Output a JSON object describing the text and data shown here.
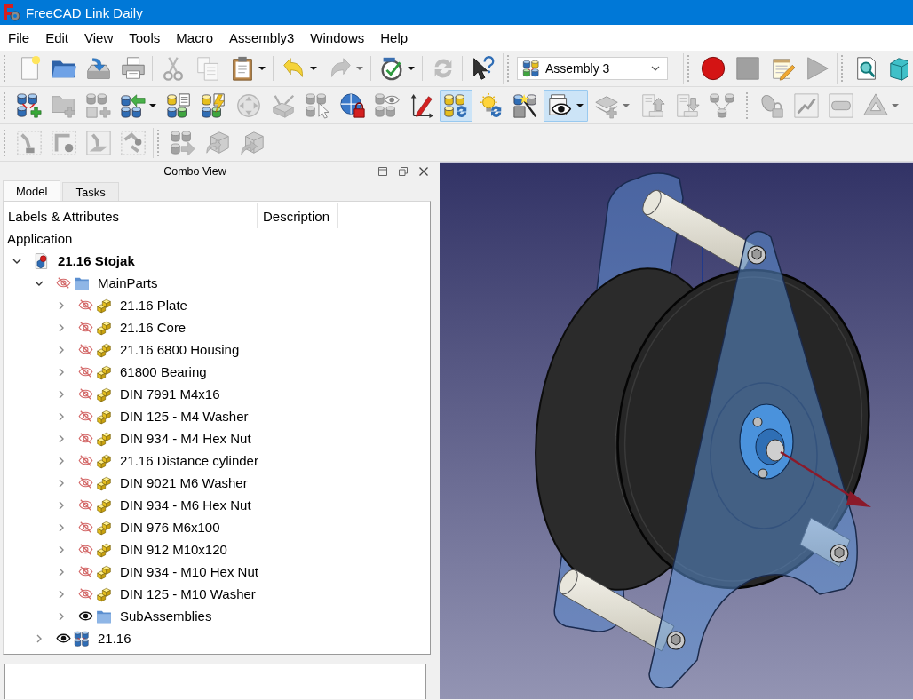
{
  "window": {
    "title": "FreeCAD Link Daily"
  },
  "menu_bar": [
    "File",
    "Edit",
    "View",
    "Tools",
    "Macro",
    "Assembly3",
    "Windows",
    "Help"
  ],
  "toolbar_rows": [
    {
      "items": [
        {
          "kind": "handle"
        },
        {
          "kind": "button",
          "disabled": false,
          "pressed": false,
          "dropdown": false
        },
        {
          "kind": "button",
          "disabled": false,
          "pressed": false,
          "dropdown": false
        },
        {
          "kind": "button",
          "disabled": false,
          "pressed": false,
          "dropdown": false
        },
        {
          "kind": "button",
          "disabled": false,
          "pressed": false,
          "dropdown": false
        },
        {
          "kind": "separator"
        },
        {
          "kind": "button",
          "disabled": true,
          "pressed": false,
          "dropdown": false
        },
        {
          "kind": "button",
          "disabled": true,
          "pressed": false,
          "dropdown": false
        },
        {
          "kind": "button",
          "disabled": false,
          "pressed": false,
          "dropdown": true
        },
        {
          "kind": "separator"
        },
        {
          "kind": "button",
          "disabled": false,
          "pressed": false,
          "dropdown": true
        },
        {
          "kind": "button",
          "disabled": true,
          "pressed": false,
          "dropdown": true
        },
        {
          "kind": "separator"
        },
        {
          "kind": "button",
          "disabled": false,
          "pressed": false,
          "dropdown": true
        },
        {
          "kind": "separator"
        },
        {
          "kind": "button",
          "disabled": true,
          "pressed": false,
          "dropdown": false
        },
        {
          "kind": "separator"
        },
        {
          "kind": "button",
          "disabled": false,
          "pressed": false,
          "dropdown": false
        },
        {
          "kind": "handle"
        },
        {
          "kind": "combo",
          "value": "Assembly 3"
        },
        {
          "kind": "handle"
        },
        {
          "kind": "button",
          "disabled": false,
          "pressed": false,
          "dropdown": false
        },
        {
          "kind": "button",
          "disabled": true,
          "pressed": false,
          "dropdown": false
        },
        {
          "kind": "button",
          "disabled": false,
          "pressed": false,
          "dropdown": false
        },
        {
          "kind": "button",
          "disabled": true,
          "pressed": false,
          "dropdown": false
        },
        {
          "kind": "handle"
        },
        {
          "kind": "button",
          "disabled": false,
          "pressed": false,
          "dropdown": false
        },
        {
          "kind": "button",
          "disabled": false,
          "pressed": false,
          "dropdown": false
        }
      ]
    },
    {
      "items": [
        {
          "kind": "handle"
        },
        {
          "kind": "button",
          "disabled": false,
          "pressed": false,
          "dropdown": false
        },
        {
          "kind": "button",
          "disabled": true,
          "pressed": false,
          "dropdown": false
        },
        {
          "kind": "button",
          "disabled": true,
          "pressed": false,
          "dropdown": false
        },
        {
          "kind": "button",
          "disabled": false,
          "pressed": false,
          "dropdown": true
        },
        {
          "kind": "button",
          "disabled": false,
          "pressed": false,
          "dropdown": false
        },
        {
          "kind": "button",
          "disabled": false,
          "pressed": false,
          "dropdown": false
        },
        {
          "kind": "button",
          "disabled": true,
          "pressed": false,
          "dropdown": false
        },
        {
          "kind": "button",
          "disabled": true,
          "pressed": false,
          "dropdown": false
        },
        {
          "kind": "button",
          "disabled": true,
          "pressed": false,
          "dropdown": false
        },
        {
          "kind": "button",
          "disabled": false,
          "pressed": false,
          "dropdown": false
        },
        {
          "kind": "button",
          "disabled": true,
          "pressed": false,
          "dropdown": false
        },
        {
          "kind": "button",
          "disabled": false,
          "pressed": false,
          "dropdown": false
        },
        {
          "kind": "button",
          "disabled": false,
          "pressed": true,
          "dropdown": false
        },
        {
          "kind": "button",
          "disabled": false,
          "pressed": false,
          "dropdown": false
        },
        {
          "kind": "button",
          "disabled": false,
          "pressed": false,
          "dropdown": false
        },
        {
          "kind": "button",
          "disabled": false,
          "pressed": true,
          "dropdown": true
        },
        {
          "kind": "button",
          "disabled": true,
          "pressed": false,
          "dropdown": true
        },
        {
          "kind": "button",
          "disabled": true,
          "pressed": false,
          "dropdown": false
        },
        {
          "kind": "button",
          "disabled": true,
          "pressed": false,
          "dropdown": false
        },
        {
          "kind": "button",
          "disabled": true,
          "pressed": false,
          "dropdown": false
        },
        {
          "kind": "handle"
        },
        {
          "kind": "button",
          "disabled": true,
          "pressed": false,
          "dropdown": false
        },
        {
          "kind": "button",
          "disabled": true,
          "pressed": false,
          "dropdown": false
        },
        {
          "kind": "button",
          "disabled": true,
          "pressed": false,
          "dropdown": false
        },
        {
          "kind": "button",
          "disabled": true,
          "pressed": false,
          "dropdown": true
        }
      ]
    },
    {
      "items": [
        {
          "kind": "handle"
        },
        {
          "kind": "button",
          "disabled": true,
          "pressed": false,
          "dropdown": false
        },
        {
          "kind": "button",
          "disabled": true,
          "pressed": false,
          "dropdown": false
        },
        {
          "kind": "button",
          "disabled": true,
          "pressed": false,
          "dropdown": false
        },
        {
          "kind": "button",
          "disabled": true,
          "pressed": false,
          "dropdown": false
        },
        {
          "kind": "handle"
        },
        {
          "kind": "button",
          "disabled": true,
          "pressed": false,
          "dropdown": false
        },
        {
          "kind": "button",
          "disabled": true,
          "pressed": false,
          "dropdown": false
        },
        {
          "kind": "button",
          "disabled": true,
          "pressed": false,
          "dropdown": false
        }
      ]
    }
  ],
  "combo_view": {
    "title": "Combo View",
    "tabs": [
      {
        "label": "Model",
        "selected": true
      },
      {
        "label": "Tasks",
        "selected": false
      }
    ],
    "tree": {
      "columns": [
        "Labels & Attributes",
        "Description"
      ],
      "section": "Application",
      "items": [
        {
          "label": "21.16 Stojak",
          "kind": "document",
          "selected": false,
          "expanded": true,
          "children": [
            {
              "label": "MainParts",
              "kind": "folder",
              "visible": false,
              "selected": false,
              "expanded": true,
              "children": [
                {
                  "label": "21.16 Plate",
                  "kind": "part",
                  "visible": false,
                  "selected": false,
                  "expanded": false
                },
                {
                  "label": "21.16 Core",
                  "kind": "part",
                  "visible": false,
                  "selected": false,
                  "expanded": false
                },
                {
                  "label": "21.16 6800 Housing",
                  "kind": "part",
                  "visible": false,
                  "selected": false,
                  "expanded": false
                },
                {
                  "label": "61800 Bearing",
                  "kind": "part",
                  "visible": false,
                  "selected": false,
                  "expanded": false
                },
                {
                  "label": "DIN 7991 M4x16",
                  "kind": "part",
                  "visible": false,
                  "selected": false,
                  "expanded": false
                },
                {
                  "label": "DIN 125 - M4 Washer",
                  "kind": "part",
                  "visible": false,
                  "selected": false,
                  "expanded": false
                },
                {
                  "label": "DIN 934 - M4 Hex Nut",
                  "kind": "part",
                  "visible": false,
                  "selected": false,
                  "expanded": false
                },
                {
                  "label": "21.16 Distance cylinder",
                  "kind": "part",
                  "visible": false,
                  "selected": false,
                  "expanded": false
                },
                {
                  "label": "DIN 9021 M6 Washer",
                  "kind": "part",
                  "visible": false,
                  "selected": false,
                  "expanded": false
                },
                {
                  "label": "DIN 934 - M6 Hex Nut",
                  "kind": "part",
                  "visible": false,
                  "selected": false,
                  "expanded": false
                },
                {
                  "label": "DIN 976 M6x100",
                  "kind": "part",
                  "visible": false,
                  "selected": false,
                  "expanded": false
                },
                {
                  "label": "DIN 912 M10x120",
                  "kind": "part",
                  "visible": false,
                  "selected": false,
                  "expanded": false
                },
                {
                  "label": "DIN 934 - M10 Hex Nut",
                  "kind": "part",
                  "visible": false,
                  "selected": false,
                  "expanded": false
                },
                {
                  "label": "DIN 125 - M10 Washer",
                  "kind": "part",
                  "visible": false,
                  "selected": false,
                  "expanded": false
                },
                {
                  "label": "SubAssemblies",
                  "kind": "folder",
                  "visible": true,
                  "selected": false,
                  "expanded": false
                }
              ]
            },
            {
              "label": "21.16",
              "kind": "assembly",
              "visible": true,
              "selected": false,
              "expanded": false
            }
          ]
        }
      ]
    }
  }
}
